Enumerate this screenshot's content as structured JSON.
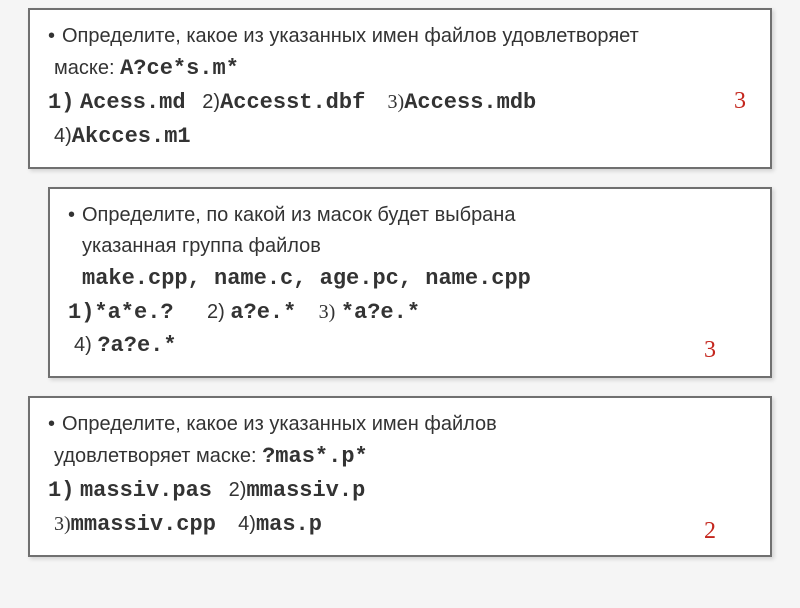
{
  "q1": {
    "prompt_l1": "Определите, какое из указанных имен файлов удовлетворяет",
    "prompt_l2": "маске:",
    "mask": "A?ce*s.m*",
    "num1": "1)",
    "opt1": "Acess.md",
    "num2": "2)",
    "opt2": "Accesst.dbf",
    "num3": "3)",
    "opt3": "Access.mdb",
    "num4": "4)",
    "opt4": "Akcces.m1",
    "answer": "3"
  },
  "q2": {
    "prompt_l1": "Определите, по какой из масок будет выбрана",
    "prompt_l2": "указанная группа файлов",
    "files": "make.cpp, name.c, age.pc, name.cpp",
    "num1": "1)",
    "opt1": "*a*e.?",
    "num2": "2)",
    "opt2": "a?e.*",
    "num3": "3)",
    "opt3": "*a?e.*",
    "num4": "4)",
    "opt4": "?a?e.*",
    "answer": "3"
  },
  "q3": {
    "prompt_l1": "Определите, какое из указанных имен файлов",
    "prompt_l2": "удовлетворяет маске:",
    "mask": "?mas*.p*",
    "num1": "1)",
    "opt1": "massiv.pas",
    "num2": "2)",
    "opt2": "mmassiv.p",
    "num3": "3)",
    "opt3": "mmassiv.cpp",
    "num4": "4)",
    "opt4": "mas.p",
    "answer": "2"
  }
}
